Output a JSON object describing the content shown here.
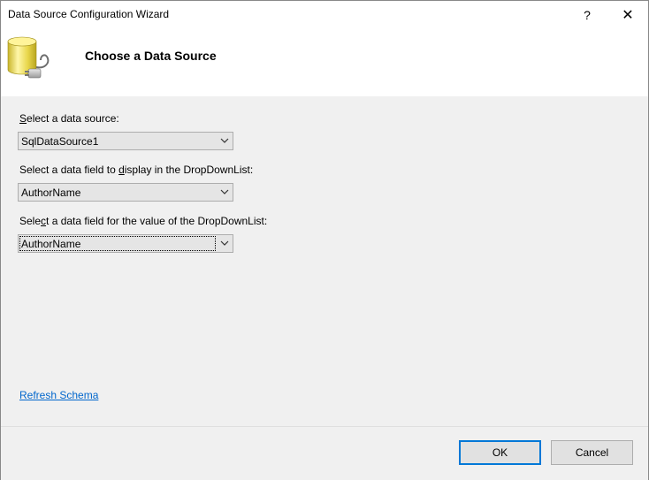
{
  "window": {
    "title": "Data Source Configuration Wizard",
    "help_label": "?",
    "close_label": "✕"
  },
  "header": {
    "title": "Choose a Data Source",
    "icon": "database-plug-icon"
  },
  "form": {
    "source_label_accel": "S",
    "source_label_rest": "elect a data source:",
    "source_value": "SqlDataSource1",
    "display_label_pre": "Select a data field to ",
    "display_label_accel": "d",
    "display_label_post": "isplay in the DropDownList:",
    "display_value": "AuthorName",
    "value_label_pre": "Sele",
    "value_label_accel": "c",
    "value_label_post": "t a data field for the value of the DropDownList:",
    "value_value": "AuthorName",
    "refresh_link": "Refresh Schema"
  },
  "footer": {
    "ok_label": "OK",
    "cancel_label": "Cancel"
  },
  "colors": {
    "content_bg": "#f0f0f0",
    "link": "#0066cc",
    "default_button_border": "#0078d7"
  }
}
